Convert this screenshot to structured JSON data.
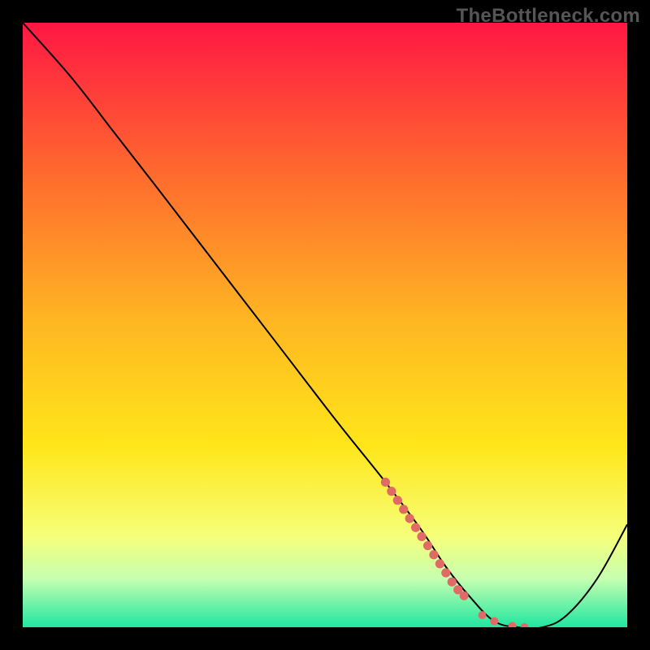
{
  "watermark": "TheBottleneck.com",
  "chart_data": {
    "type": "line",
    "title": "",
    "xlabel": "",
    "ylabel": "",
    "xlim": [
      0,
      100
    ],
    "ylim": [
      0,
      100
    ],
    "grid": false,
    "legend": false,
    "background": {
      "gradient_stops": [
        {
          "offset": 0,
          "color": "#ff1744"
        },
        {
          "offset": 25,
          "color": "#ff6a2e"
        },
        {
          "offset": 50,
          "color": "#ffb822"
        },
        {
          "offset": 70,
          "color": "#ffe61a"
        },
        {
          "offset": 85,
          "color": "#f6ff7a"
        },
        {
          "offset": 92,
          "color": "#c6ffb0"
        },
        {
          "offset": 100,
          "color": "#1fe6a0"
        }
      ],
      "note": "vertical gradient from top (red) to bottom (green)"
    },
    "series": [
      {
        "name": "curve",
        "color": "#000000",
        "x": [
          0,
          8,
          15,
          22,
          32,
          42,
          52,
          60,
          66,
          70,
          74,
          78,
          82,
          86,
          90,
          95,
          100
        ],
        "y": [
          100,
          91,
          82,
          73,
          60,
          47,
          34,
          24,
          16,
          10,
          5,
          1,
          0,
          0,
          2,
          8,
          17
        ]
      }
    ],
    "markers": {
      "name": "highlight-dots",
      "color": "#e06a66",
      "points": [
        {
          "x": 60,
          "y": 24,
          "r": 3.2
        },
        {
          "x": 61,
          "y": 22.5,
          "r": 3.2
        },
        {
          "x": 62,
          "y": 21,
          "r": 3.2
        },
        {
          "x": 63,
          "y": 19.5,
          "r": 3.2
        },
        {
          "x": 64,
          "y": 18,
          "r": 3.2
        },
        {
          "x": 65,
          "y": 16.5,
          "r": 3.2
        },
        {
          "x": 66,
          "y": 15,
          "r": 3.2
        },
        {
          "x": 67,
          "y": 13.5,
          "r": 3.2
        },
        {
          "x": 68,
          "y": 12,
          "r": 3.2
        },
        {
          "x": 69,
          "y": 10.5,
          "r": 3.2
        },
        {
          "x": 70,
          "y": 9,
          "r": 3.2
        },
        {
          "x": 71,
          "y": 7.5,
          "r": 3.2
        },
        {
          "x": 72,
          "y": 6.2,
          "r": 3.2
        },
        {
          "x": 73,
          "y": 5.2,
          "r": 3.0
        },
        {
          "x": 76,
          "y": 2.0,
          "r": 2.4
        },
        {
          "x": 78,
          "y": 1.0,
          "r": 2.4
        },
        {
          "x": 81,
          "y": 0.2,
          "r": 2.4
        },
        {
          "x": 83,
          "y": 0.0,
          "r": 2.4
        }
      ]
    }
  }
}
